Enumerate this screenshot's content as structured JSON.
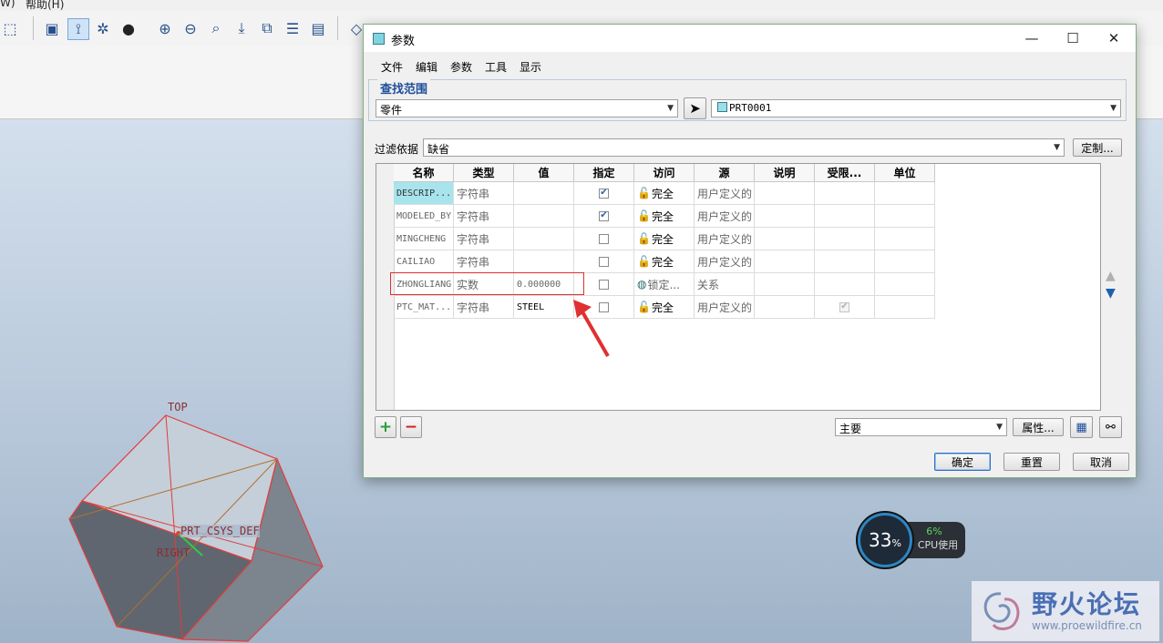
{
  "app": {
    "menu": {
      "window": "W)",
      "help": "帮助(H)"
    },
    "model_labels": {
      "top": "TOP",
      "csys": "PRT_CSYS_DEF",
      "right": "RIGHT"
    }
  },
  "dialog": {
    "title": "参数",
    "window_buttons": {
      "minimize": "—",
      "maximize": "☐",
      "close": "✕"
    },
    "menu": [
      "文件",
      "编辑",
      "参数",
      "工具",
      "显示"
    ],
    "scope": {
      "legend": "查找范围",
      "type_value": "零件",
      "model_value": "PRT0001"
    },
    "filter": {
      "label": "过滤依据",
      "value": "缺省",
      "customize_button": "定制..."
    },
    "table": {
      "columns": [
        "名称",
        "类型",
        "值",
        "指定",
        "访问",
        "源",
        "说明",
        "受限...",
        "单位"
      ],
      "rows": [
        {
          "name": "DESCRIP...",
          "type": "字符串",
          "value": "",
          "designated": true,
          "access": "完全",
          "source": "用户定义的",
          "description": "",
          "restricted": null,
          "unit": ""
        },
        {
          "name": "MODELED_BY",
          "type": "字符串",
          "value": "",
          "designated": true,
          "access": "完全",
          "source": "用户定义的",
          "description": "",
          "restricted": null,
          "unit": ""
        },
        {
          "name": "MINGCHENG",
          "type": "字符串",
          "value": "",
          "designated": false,
          "access": "完全",
          "source": "用户定义的",
          "description": "",
          "restricted": null,
          "unit": ""
        },
        {
          "name": "CAILIAO",
          "type": "字符串",
          "value": "",
          "designated": false,
          "access": "完全",
          "source": "用户定义的",
          "description": "",
          "restricted": null,
          "unit": ""
        },
        {
          "name": "ZHONGLIANG",
          "type": "实数",
          "value": "0.000000",
          "designated": false,
          "access": "锁定...",
          "source": "关系",
          "description": "",
          "restricted": null,
          "unit": ""
        },
        {
          "name": "PTC_MAT...",
          "type": "字符串",
          "value": "STEEL",
          "designated": false,
          "access": "完全",
          "source": "用户定义的",
          "description": "",
          "restricted": true,
          "unit": ""
        }
      ]
    },
    "bottom": {
      "add_label": "+",
      "remove_label": "−",
      "view_value": "主要",
      "properties_button": "属性..."
    },
    "actions": {
      "ok": "确定",
      "reset": "重置",
      "cancel": "取消"
    }
  },
  "cpu": {
    "usage": "33",
    "percent_sign": "%",
    "cpu_pct": "6%",
    "cpu_label": "CPU使用"
  },
  "watermark": {
    "title": "野火论坛",
    "url": "www.proewildfire.cn"
  },
  "colors": {
    "accent": "#1f4e9b",
    "selected_cell": "#a8e4ec",
    "annotation": "#e03030"
  }
}
